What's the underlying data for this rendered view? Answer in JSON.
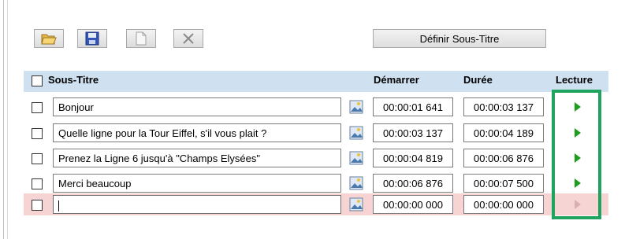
{
  "toolbar": {
    "buttons": [
      {
        "name": "open-folder",
        "icon": "folder-open-icon",
        "enabled": true
      },
      {
        "name": "save",
        "icon": "save-icon",
        "enabled": true
      },
      {
        "name": "new",
        "icon": "new-document-icon",
        "enabled": false
      },
      {
        "name": "delete",
        "icon": "close-icon",
        "enabled": false
      }
    ],
    "define_label": "Définir Sous-Titre"
  },
  "table": {
    "headers": {
      "subtitle": "Sous-Titre",
      "start": "Démarrer",
      "duration": "Durée",
      "play": "Lecture"
    },
    "rows": [
      {
        "text": "Bonjour",
        "start": "00:00:01 641",
        "duration": "00:00:03 137",
        "selected": false
      },
      {
        "text": "Quelle ligne pour la Tour Eiffel, s'il vous plait ?",
        "start": "00:00:03 137",
        "duration": "00:00:04 189",
        "selected": false
      },
      {
        "text": "Prenez la Ligne 6 jusqu'à \"Champs Elysées\"",
        "start": "00:00:04 819",
        "duration": "00:00:06 876",
        "selected": false
      },
      {
        "text": "Merci beaucoup",
        "start": "00:00:06 876",
        "duration": "00:00:07 500",
        "selected": false
      },
      {
        "text": "",
        "start": "00:00:00 000",
        "duration": "00:00:00 000",
        "selected": true
      }
    ]
  },
  "colors": {
    "header_band": "#cfe0f1",
    "selected_row": "#f7d4d4",
    "play_green": "#1e9e1e",
    "highlight_frame": "#1fa460"
  }
}
